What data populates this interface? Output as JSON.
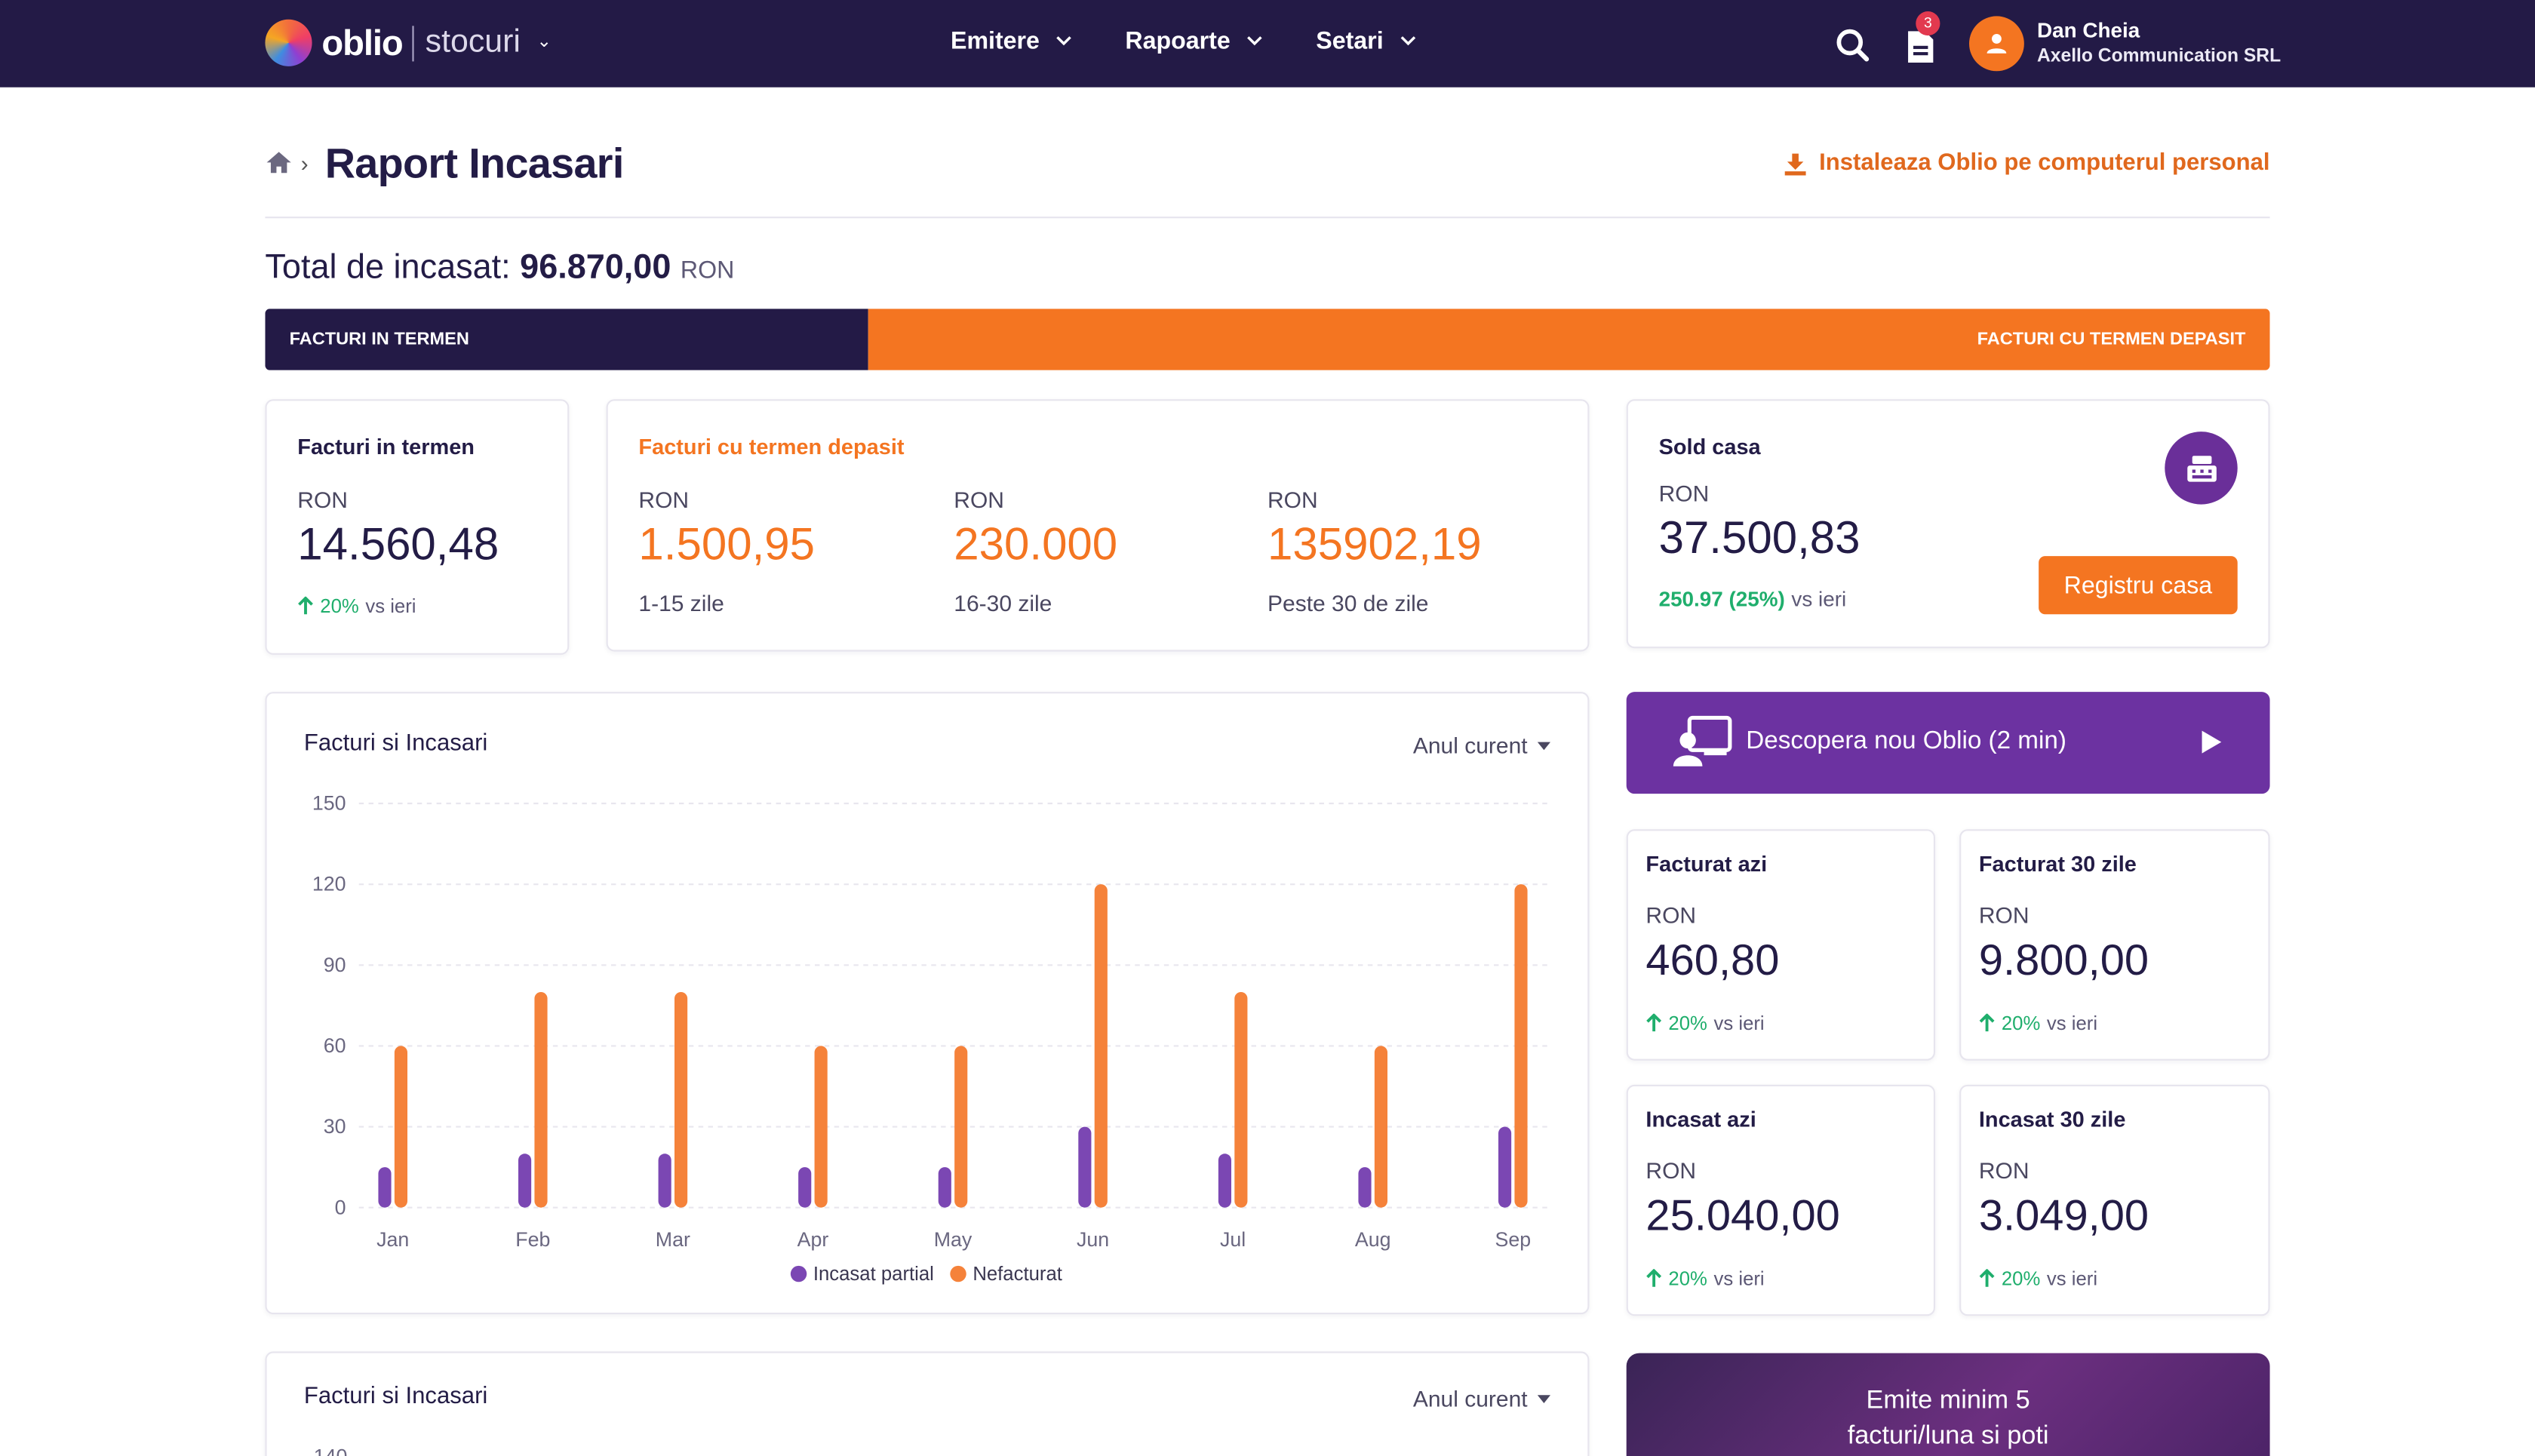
{
  "topbar": {
    "brand": "oblio",
    "module": "stocuri",
    "nav": [
      "Emitere",
      "Rapoarte",
      "Setari"
    ],
    "notification_count": "3",
    "user_name": "Dan Cheia",
    "user_company": "Axello Communication SRL"
  },
  "header": {
    "title": "Raport Incasari",
    "install_link": "Instaleaza Oblio pe computerul personal"
  },
  "total": {
    "label": "Total de incasat:",
    "value": "96.870,00",
    "currency": "RON"
  },
  "split_bar": {
    "left_label": "FACTURI IN TERMEN",
    "right_label": "FACTURI CU TERMEN DEPASIT"
  },
  "in_term": {
    "title": "Facturi in termen",
    "currency": "RON",
    "value": "14.560,48",
    "delta": "20%",
    "delta_suffix": "vs ieri"
  },
  "overdue": {
    "title": "Facturi cu termen depasit",
    "items": [
      {
        "currency": "RON",
        "value": "1.500,95",
        "range": "1-15 zile"
      },
      {
        "currency": "RON",
        "value": "230.000",
        "range": "16-30 zile"
      },
      {
        "currency": "RON",
        "value": "135902,19",
        "range": "Peste 30 de zile"
      }
    ]
  },
  "cash": {
    "title": "Sold casa",
    "currency": "RON",
    "value": "37.500,83",
    "delta": "250.97 (25%)",
    "delta_suffix": "vs ieri",
    "button": "Registru casa"
  },
  "promo": {
    "label": "Descopera nou Oblio (2 min)"
  },
  "chart_card": {
    "title": "Facturi si Incasari",
    "period": "Anul curent"
  },
  "chart_data": {
    "type": "bar",
    "categories": [
      "Jan",
      "Feb",
      "Mar",
      "Apr",
      "May",
      "Jun",
      "Jul",
      "Aug",
      "Sep"
    ],
    "series": [
      {
        "name": "Incasat partial",
        "color": "#7b47b3",
        "values": [
          15,
          20,
          20,
          15,
          15,
          30,
          20,
          15,
          30
        ]
      },
      {
        "name": "Nefacturat",
        "color": "#f5823a",
        "values": [
          60,
          80,
          80,
          60,
          60,
          120,
          80,
          60,
          120
        ]
      }
    ],
    "yticks": [
      "0",
      "30",
      "60",
      "90",
      "120",
      "150"
    ],
    "ylim": [
      0,
      150
    ],
    "grid": true,
    "legend": "bottom"
  },
  "stats": [
    {
      "title": "Facturat azi",
      "currency": "RON",
      "value": "460,80",
      "delta": "20%",
      "delta_suffix": "vs ieri"
    },
    {
      "title": "Facturat 30 zile",
      "currency": "RON",
      "value": "9.800,00",
      "delta": "20%",
      "delta_suffix": "vs ieri"
    },
    {
      "title": "Incasat azi",
      "currency": "RON",
      "value": "25.040,00",
      "delta": "20%",
      "delta_suffix": "vs ieri"
    },
    {
      "title": "Incasat 30 zile",
      "currency": "RON",
      "value": "3.049,00",
      "delta": "20%",
      "delta_suffix": "vs ieri"
    }
  ],
  "chart_card2": {
    "title": "Facturi si Incasari",
    "period": "Anul curent",
    "top_tick": "140"
  },
  "promo2": {
    "line1": "Emite minim 5",
    "line2": "facturi/luna si poti"
  }
}
